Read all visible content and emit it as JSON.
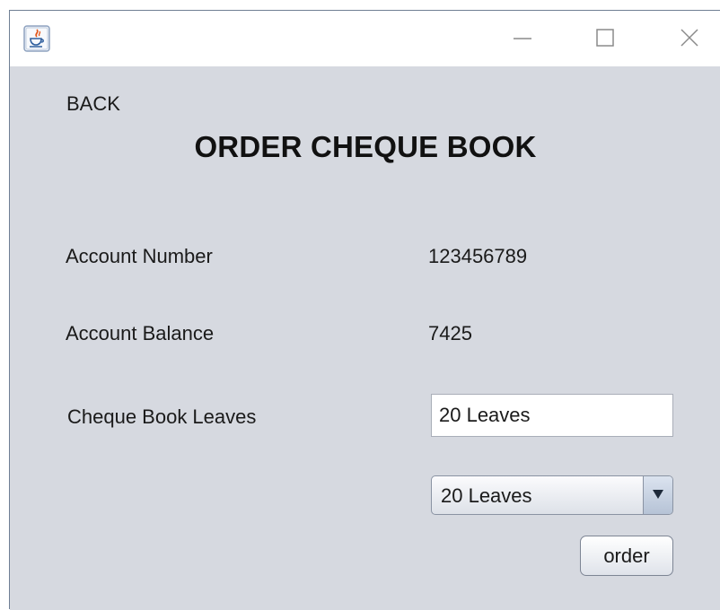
{
  "window": {
    "icon": "java-icon",
    "controls": {
      "minimize": "minimize-icon",
      "maximize": "maximize-icon",
      "close": "close-icon"
    }
  },
  "nav": {
    "back_label": "BACK"
  },
  "page": {
    "title": "ORDER CHEQUE BOOK"
  },
  "account": {
    "number_label": "Account Number",
    "number_value": "123456789",
    "balance_label": "Account Balance",
    "balance_value": "7425"
  },
  "cheque": {
    "leaves_label": "Cheque Book Leaves",
    "leaves_field_value": "20 Leaves",
    "leaves_selected": "20 Leaves",
    "order_label": "order"
  },
  "colors": {
    "panel_background": "#d6d9e0",
    "titlebar_background": "#ffffff"
  }
}
